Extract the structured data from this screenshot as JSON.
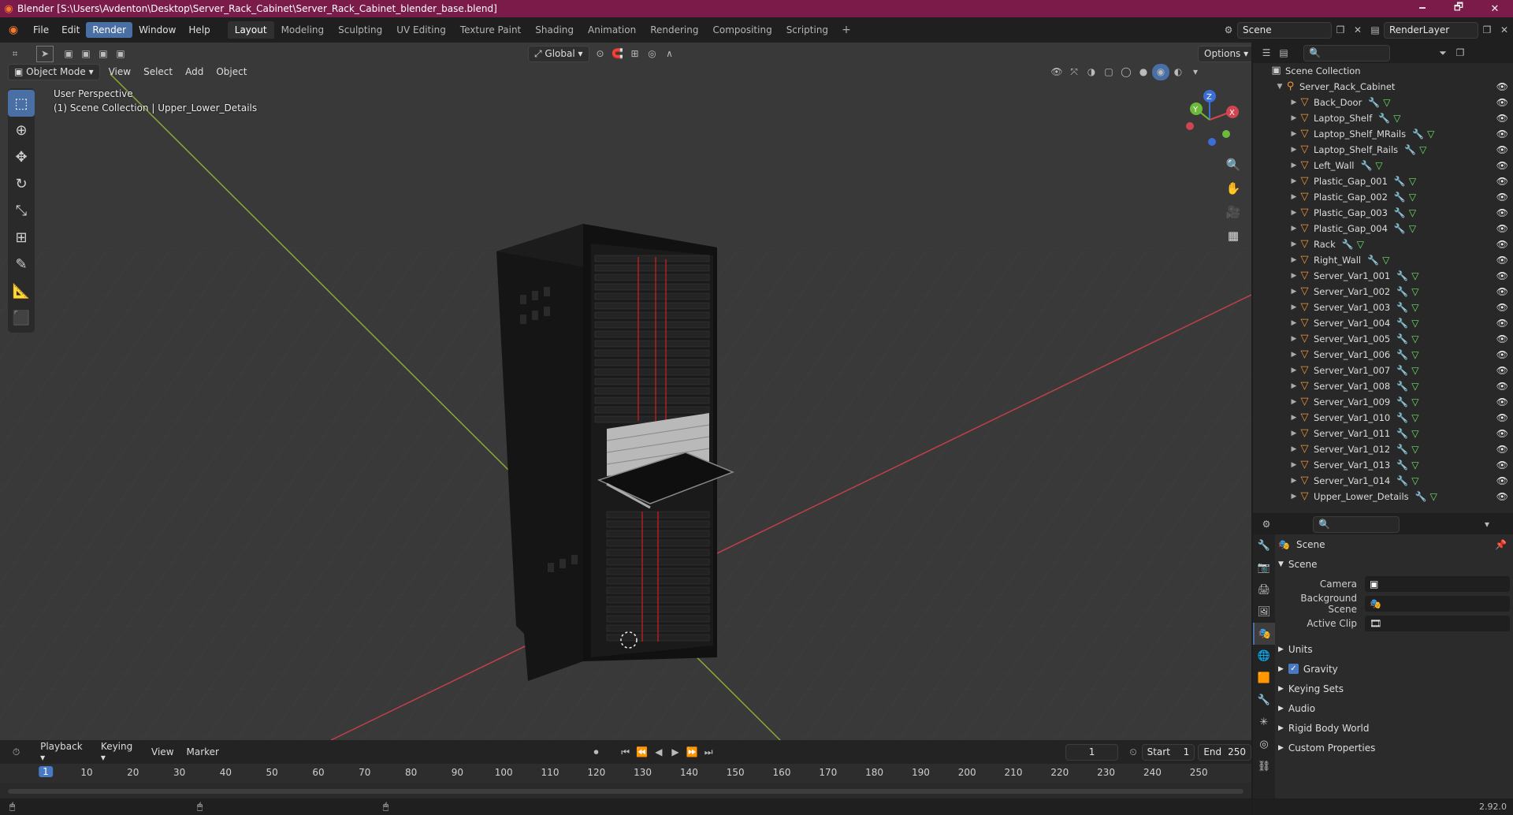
{
  "window": {
    "title": "Blender [S:\\Users\\Avdenton\\Desktop\\Server_Rack_Cabinet\\Server_Rack_Cabinet_blender_base.blend]",
    "min": "🗕",
    "max": "🗗",
    "close": "✕"
  },
  "menubar": {
    "file": "File",
    "edit": "Edit",
    "render": "Render",
    "window": "Window",
    "help": "Help",
    "workspaces": [
      "Layout",
      "Modeling",
      "Sculpting",
      "UV Editing",
      "Texture Paint",
      "Shading",
      "Animation",
      "Rendering",
      "Compositing",
      "Scripting"
    ],
    "add_workspace": "+",
    "scene": "Scene",
    "render_layer": "RenderLayer"
  },
  "viewport": {
    "mode": "Object Mode",
    "menus": [
      "View",
      "Select",
      "Add",
      "Object"
    ],
    "orientation": "Global",
    "options": "Options",
    "overlay_line1": "User Perspective",
    "overlay_line2": "(1) Scene Collection | Upper_Lower_Details",
    "gizmo": {
      "x": "X",
      "y": "Y",
      "z": "Z"
    }
  },
  "outliner": {
    "root": "Scene Collection",
    "collection": "Server_Rack_Cabinet",
    "objects": [
      "Back_Door",
      "Laptop_Shelf",
      "Laptop_Shelf_MRails",
      "Laptop_Shelf_Rails",
      "Left_Wall",
      "Plastic_Gap_001",
      "Plastic_Gap_002",
      "Plastic_Gap_003",
      "Plastic_Gap_004",
      "Rack",
      "Right_Wall",
      "Server_Var1_001",
      "Server_Var1_002",
      "Server_Var1_003",
      "Server_Var1_004",
      "Server_Var1_005",
      "Server_Var1_006",
      "Server_Var1_007",
      "Server_Var1_008",
      "Server_Var1_009",
      "Server_Var1_010",
      "Server_Var1_011",
      "Server_Var1_012",
      "Server_Var1_013",
      "Server_Var1_014",
      "Upper_Lower_Details"
    ]
  },
  "properties": {
    "context": "Scene",
    "panel": "Scene",
    "camera_label": "Camera",
    "background_scene_label": "Background Scene",
    "active_clip_label": "Active Clip",
    "sections": [
      "Units",
      "Gravity",
      "Keying Sets",
      "Audio",
      "Rigid Body World",
      "Custom Properties"
    ],
    "gravity_checked": true
  },
  "timeline": {
    "menus": [
      "Playback",
      "Keying",
      "View",
      "Marker"
    ],
    "current_frame": "1",
    "start_label": "Start",
    "start": "1",
    "end_label": "End",
    "end": "250",
    "ticks": [
      "10",
      "20",
      "30",
      "40",
      "50",
      "60",
      "70",
      "80",
      "90",
      "100",
      "110",
      "120",
      "130",
      "140",
      "150",
      "160",
      "170",
      "180",
      "190",
      "200",
      "210",
      "220",
      "230",
      "240",
      "250"
    ],
    "playhead": "1"
  },
  "status": {
    "version": "2.92.0"
  }
}
